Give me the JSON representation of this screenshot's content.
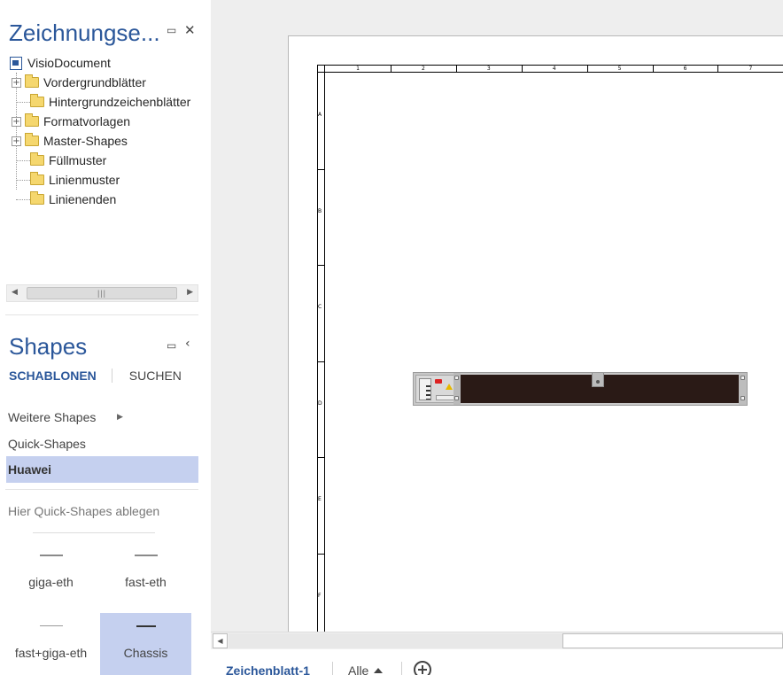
{
  "explorer": {
    "title": "Zeichnungse...",
    "restore_glyph": "🗖",
    "close_glyph": "✕",
    "tree": {
      "root": "VisioDocument",
      "items": [
        {
          "label": "Vordergrundblätter",
          "expandable": true
        },
        {
          "label": "Hintergrundzeichenblätter",
          "expandable": false
        },
        {
          "label": "Formatvorlagen",
          "expandable": true
        },
        {
          "label": "Master-Shapes",
          "expandable": true
        },
        {
          "label": "Füllmuster",
          "expandable": false
        },
        {
          "label": "Linienmuster",
          "expandable": false
        },
        {
          "label": "Linienenden",
          "expandable": false
        }
      ]
    },
    "scroll_thumb_glyph": "|||"
  },
  "shapes_pane": {
    "title": "Shapes",
    "restore_glyph": "🗖",
    "collapse_glyph": "‹",
    "tabs": {
      "stencils": "SCHABLONEN",
      "search": "SUCHEN"
    },
    "stencils": {
      "more": "Weitere Shapes",
      "quick": "Quick-Shapes",
      "active": "Huawei"
    },
    "drop_hint": "Hier Quick-Shapes ablegen",
    "shapes": [
      {
        "label": "giga-eth"
      },
      {
        "label": "fast-eth"
      },
      {
        "label": "fast+giga-eth"
      },
      {
        "label": "Chassis",
        "selected": true
      }
    ]
  },
  "canvas": {
    "columns": [
      "1",
      "2",
      "3",
      "4",
      "5",
      "6",
      "7"
    ],
    "rows": [
      "A",
      "B",
      "C",
      "D",
      "E",
      "F"
    ],
    "shape_name": "Chassis"
  },
  "page_tabs": {
    "active": "Zeichenblatt-1",
    "all": "Alle",
    "add_icon": "plus-circle-icon"
  },
  "colors": {
    "accent": "#2b579a",
    "selection": "#c5d0ef",
    "chassis_body": "#2a1a16"
  }
}
